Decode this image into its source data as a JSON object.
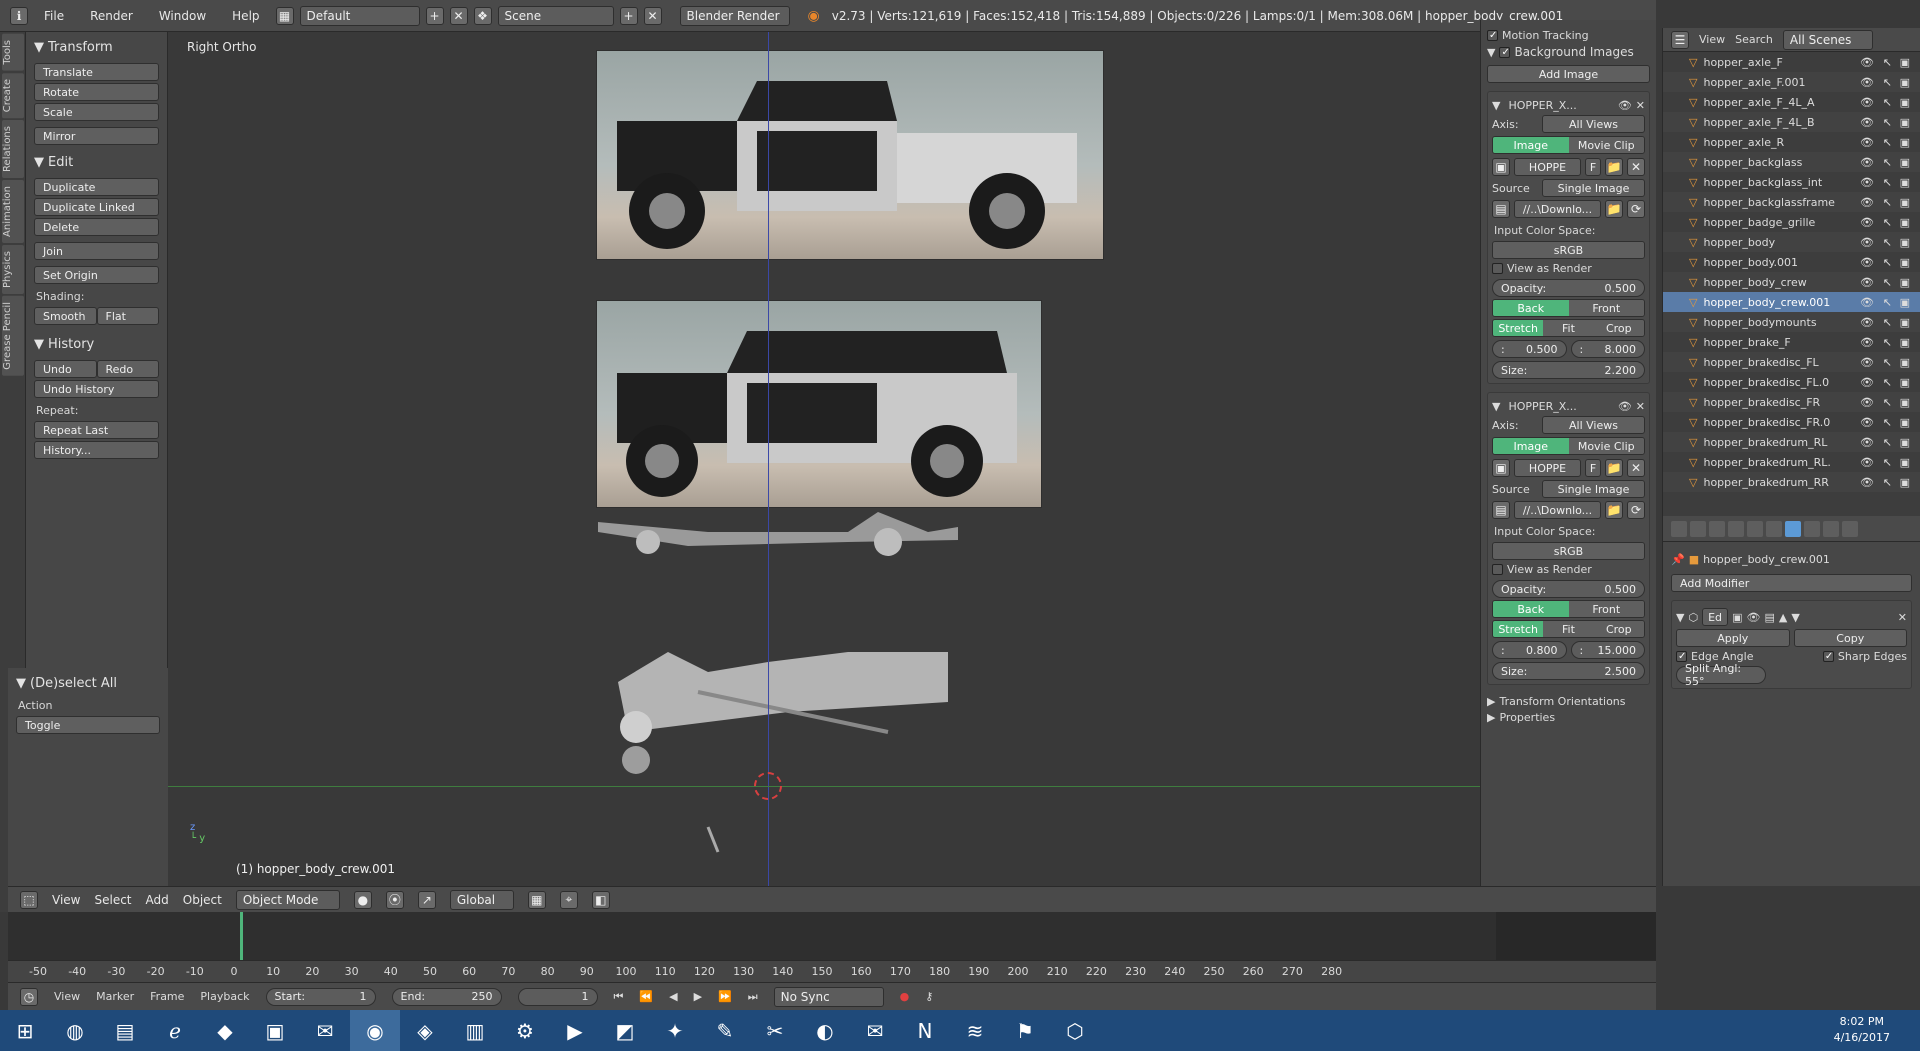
{
  "topbar": {
    "menus": [
      "File",
      "Render",
      "Window",
      "Help"
    ],
    "layout": "Default",
    "scene": "Scene",
    "engine": "Blender Render",
    "stats": "v2.73 | Verts:121,619 | Faces:152,418 | Tris:154,889 | Objects:0/226 | Lamps:0/1 | Mem:308.06M | hopper_body_crew.001"
  },
  "vtabs": [
    "Tools",
    "Create",
    "Relations",
    "Animation",
    "Physics",
    "Grease Pencil"
  ],
  "shelf": {
    "transform": {
      "title": "Transform",
      "buttons": [
        "Translate",
        "Rotate",
        "Scale"
      ],
      "mirror": "Mirror"
    },
    "edit": {
      "title": "Edit",
      "buttons": [
        "Duplicate",
        "Duplicate Linked",
        "Delete"
      ],
      "join": "Join",
      "set_origin": "Set Origin",
      "shading_label": "Shading:",
      "smooth": "Smooth",
      "flat": "Flat"
    },
    "history": {
      "title": "History",
      "undo": "Undo",
      "redo": "Redo",
      "undo_history": "Undo History",
      "repeat_label": "Repeat:",
      "repeat_last": "Repeat Last",
      "history": "History..."
    },
    "deselect": {
      "title": "(De)select All",
      "action_label": "Action",
      "action_value": "Toggle"
    }
  },
  "viewport": {
    "label": "Right Ortho",
    "object_label": "(1) hopper_body_crew.001"
  },
  "vheader": {
    "menus": [
      "View",
      "Select",
      "Add",
      "Object"
    ],
    "mode": "Object Mode",
    "orientation": "Global"
  },
  "npanel": {
    "motion_tracking": "Motion Tracking",
    "background_images": "Background Images",
    "add_image": "Add Image",
    "blocks": [
      {
        "name": "HOPPER_X...",
        "axis_label": "Axis:",
        "axis": "All Views",
        "image": "Image",
        "movie": "Movie Clip",
        "img_name": "HOPPE",
        "img_f": "F",
        "source_label": "Source",
        "source": "Single Image",
        "path": "//..\\Downlo...",
        "ics_label": "Input Color Space:",
        "ics": "sRGB",
        "view_render": "View as Render",
        "opacity_label": "Opacity:",
        "opacity": "0.500",
        "back": "Back",
        "front": "Front",
        "stretch": "Stretch",
        "fit": "Fit",
        "crop": "Crop",
        "x": "0.500",
        "y": "8.000",
        "size_label": "Size:",
        "size": "2.200"
      },
      {
        "name": "HOPPER_X...",
        "axis_label": "Axis:",
        "axis": "All Views",
        "image": "Image",
        "movie": "Movie Clip",
        "img_name": "HOPPE",
        "img_f": "F",
        "source_label": "Source",
        "source": "Single Image",
        "path": "//..\\Downlo...",
        "ics_label": "Input Color Space:",
        "ics": "sRGB",
        "view_render": "View as Render",
        "opacity_label": "Opacity:",
        "opacity": "0.500",
        "back": "Back",
        "front": "Front",
        "stretch": "Stretch",
        "fit": "Fit",
        "crop": "Crop",
        "x": "0.800",
        "y": "15.000",
        "size_label": "Size:",
        "size": "2.500"
      }
    ],
    "transform_orientations": "Transform Orientations",
    "properties": "Properties"
  },
  "outliner": {
    "menus": [
      "View",
      "Search"
    ],
    "scope": "All Scenes",
    "items": [
      "hopper_axle_F",
      "hopper_axle_F.001",
      "hopper_axle_F_4L_A",
      "hopper_axle_F_4L_B",
      "hopper_axle_R",
      "hopper_backglass",
      "hopper_backglass_int",
      "hopper_backglassframe",
      "hopper_badge_grille",
      "hopper_body",
      "hopper_body.001",
      "hopper_body_crew",
      "hopper_body_crew.001",
      "hopper_bodymounts",
      "hopper_brake_F",
      "hopper_brakedisc_FL",
      "hopper_brakedisc_FL.0",
      "hopper_brakedisc_FR",
      "hopper_brakedisc_FR.0",
      "hopper_brakedrum_RL",
      "hopper_brakedrum_RL.",
      "hopper_brakedrum_RR"
    ],
    "selected_index": 12
  },
  "props": {
    "object": "hopper_body_crew.001",
    "add_modifier": "Add Modifier",
    "mod_name": "Ed",
    "apply": "Apply",
    "copy": "Copy",
    "edge_angle": "Edge Angle",
    "sharp_edges": "Sharp Edges",
    "split_angle": "Split Angl:  55°"
  },
  "timeline": {
    "ticks": [
      "-50",
      "-40",
      "-30",
      "-20",
      "-10",
      "0",
      "10",
      "20",
      "30",
      "40",
      "50",
      "60",
      "70",
      "80",
      "90",
      "100",
      "110",
      "120",
      "130",
      "140",
      "150",
      "160",
      "170",
      "180",
      "190",
      "200",
      "210",
      "220",
      "230",
      "240",
      "250",
      "260",
      "270",
      "280"
    ],
    "menus": [
      "View",
      "Marker",
      "Frame",
      "Playback"
    ],
    "start_label": "Start:",
    "start": "1",
    "end_label": "End:",
    "end": "250",
    "current": "1",
    "sync": "No Sync"
  },
  "taskbar": {
    "time": "8:02 PM",
    "date": "4/16/2017"
  }
}
